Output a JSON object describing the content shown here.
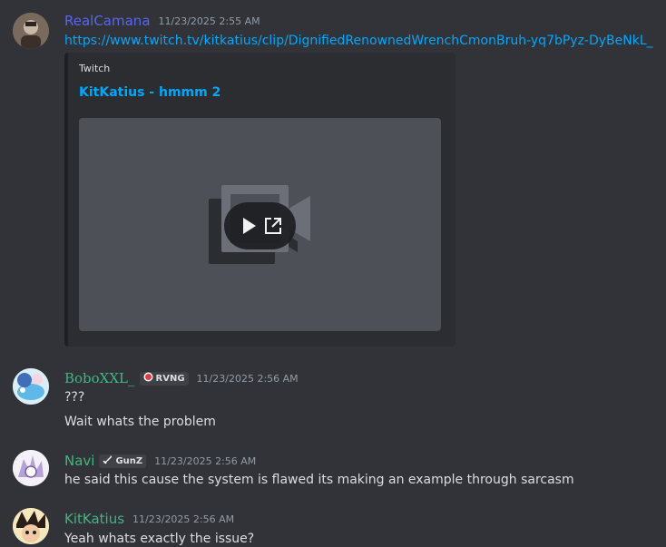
{
  "messages": [
    {
      "username": "RealCamana",
      "username_color": "#5865f2",
      "timestamp": "11/23/2025 2:55 AM",
      "link": "https://www.twitch.tv/kitkatius/clip/DignifiedRenownedWrenchCmonBruh-yq7bPyz-DyBeNkL_",
      "embed": {
        "provider": "Twitch",
        "title": "KitKatius - hmmm 2"
      }
    },
    {
      "username": "BoboXXL_",
      "username_color": "#43b581",
      "tag": "RVNG",
      "timestamp": "11/23/2025 2:56 AM",
      "lines": [
        "???",
        "Wait whats the problem"
      ]
    },
    {
      "username": "Navi",
      "username_color": "#43b581",
      "tag": "GunZ",
      "timestamp": "11/23/2025 2:56 AM",
      "lines": [
        "he said this cause the system is flawed its making an example through sarcasm"
      ]
    },
    {
      "username": "KitKatius",
      "username_color": "#43b581",
      "timestamp": "11/23/2025 2:56 AM",
      "lines": [
        "Yeah whats exactly the issue?"
      ]
    }
  ],
  "icons": {
    "video_placeholder": "video-camera-icon",
    "play": "play-icon",
    "open_external": "open-external-icon",
    "tag_rvng": "record-icon",
    "tag_gunz": "sword-icon"
  }
}
